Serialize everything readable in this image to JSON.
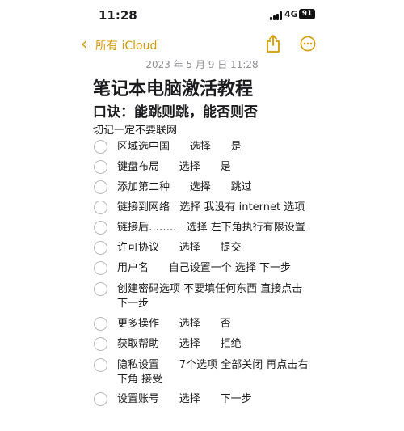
{
  "status_bar": {
    "time": "11:28",
    "network": "4G",
    "battery": "91"
  },
  "nav": {
    "back_label": "所有 iCloud",
    "share_icon": "share-icon",
    "more_icon": "ellipsis-circle-icon",
    "accent_color": "#d99a00"
  },
  "note": {
    "date": "2023 年 5 月 9 日 11:28",
    "title": "笔记本电脑激活教程",
    "subtitle": "口诀：能跳则跳，能否则否",
    "warning": "切记一定不要联网",
    "items": [
      {
        "text": "区域选中国\t\t选择\t\t是"
      },
      {
        "text": "键盘布局\t\t选择\t\t是"
      },
      {
        "text": "添加第二种\t\t选择\t\t跳过"
      },
      {
        "text": "链接到网络\t选择 我没有 internet 选项"
      },
      {
        "text": "链接后……..\t选择 左下角执行有限设置"
      },
      {
        "text": "许可协议\t\t选择\t\t提交"
      },
      {
        "text": "用户名\t\t自己设置一个 选择 下一步"
      },
      {
        "text": "创建密码选项 不要填任何东西 直接点击下一步"
      },
      {
        "text": "更多操作\t\t选择\t\t否"
      },
      {
        "text": "获取帮助\t\t选择\t\t拒绝"
      },
      {
        "text": "隐私设置\t\t7个选项 全部关闭 再点击右下角 接受"
      },
      {
        "text": "设置账号\t\t选择\t\t下一步"
      }
    ]
  }
}
